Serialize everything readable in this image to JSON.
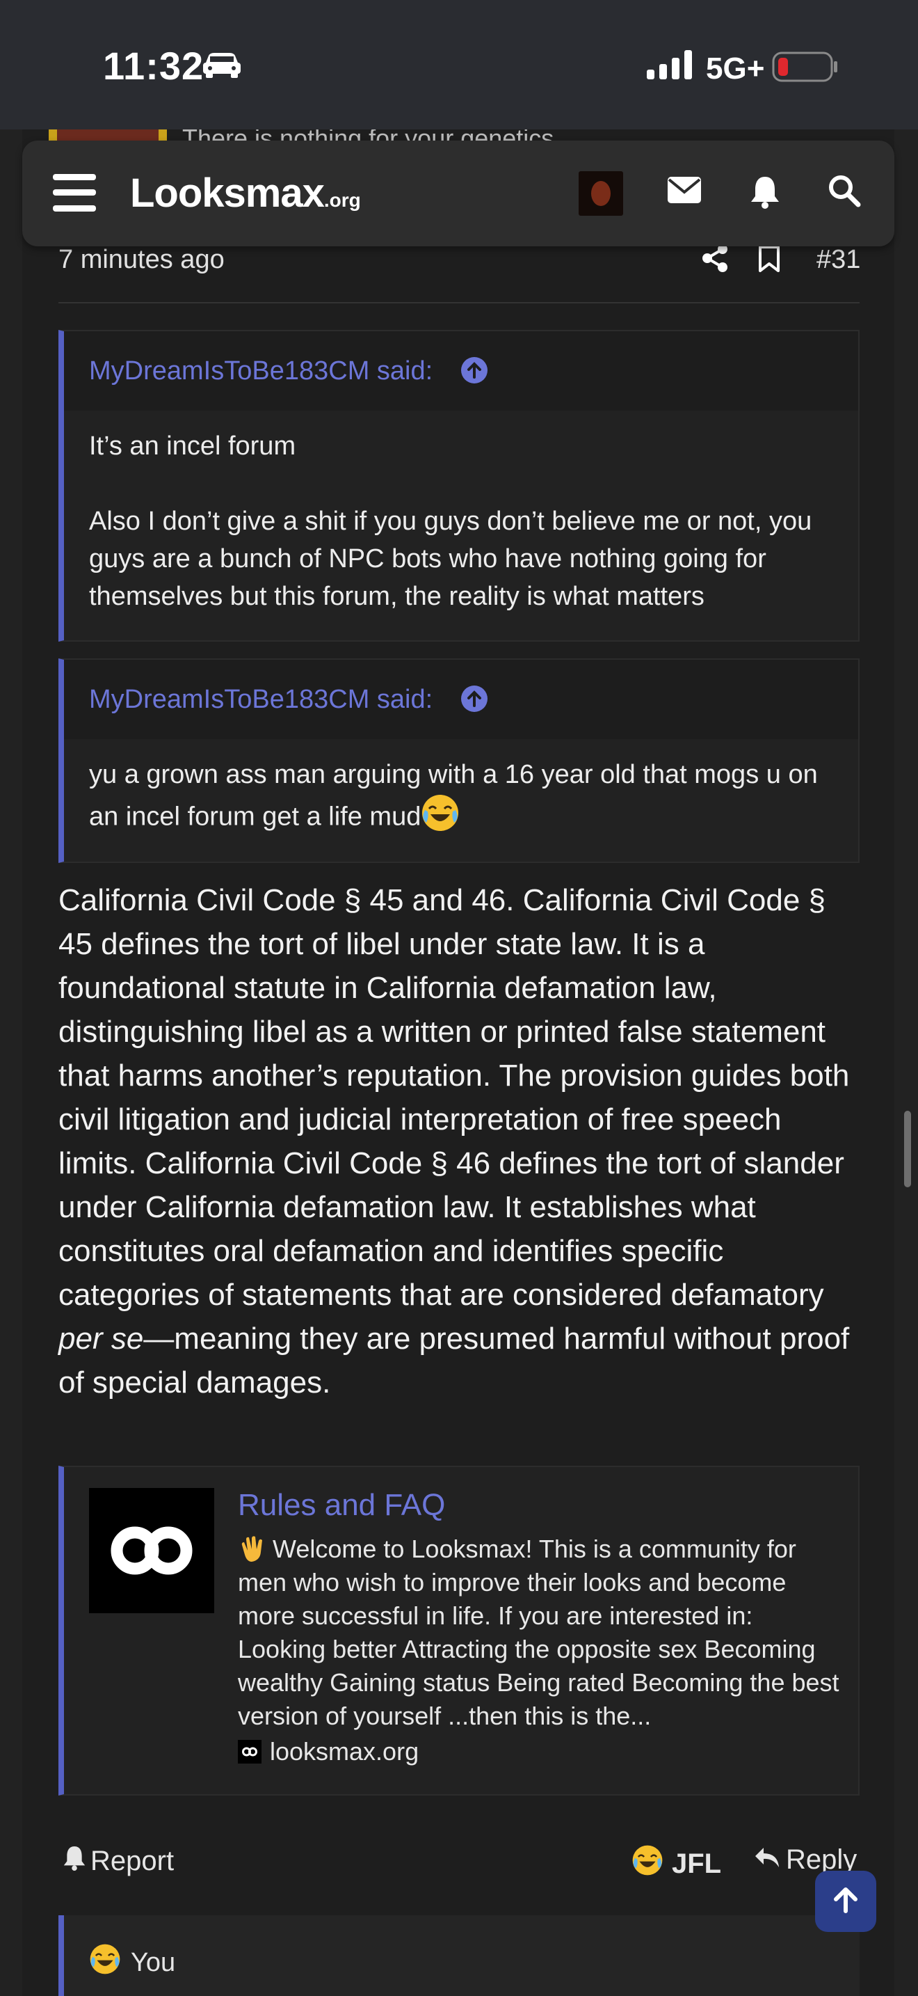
{
  "status_bar": {
    "time": "11:32",
    "network": "5G+"
  },
  "previous_post": {
    "peek_text": "There is nothing for your genetics"
  },
  "navbar": {
    "logo": "Looksmax",
    "logo_suffix": ".org"
  },
  "post": {
    "time": "7 minutes ago",
    "number": "#31",
    "quotes": [
      {
        "author": "MyDreamIsToBe183CM said:",
        "paragraphs": [
          "It’s an incel forum",
          "Also I don’t give a shit if you guys don’t believe me or not, you guys are a bunch of NPC bots who have nothing going for themselves but this forum, the reality is what matters"
        ]
      },
      {
        "author": "MyDreamIsToBe183CM said:",
        "text": "yu a grown ass man arguing with a 16 year old that mogs u on an incel forum get a life mud"
      }
    ],
    "body_part1": "California Civil Code § 45 and 46. California Civil Code § 45 defines the tort of libel under state law. It is a foundational statute in California defamation law, distinguishing libel as a written or printed false statement that harms another’s reputation. The provision guides both civil litigation and judicial interpretation of free speech limits. California Civil Code § 46 defines the tort of slander under California defamation law. It establishes what constitutes oral defamation and identifies specific categories of statements that are considered defamatory ",
    "body_italic": "per se",
    "body_part2": "—meaning they are presumed harmful without proof of special damages.",
    "unfurl": {
      "title": "Rules and FAQ",
      "description": "Welcome to Looksmax! This is a community for men who wish to improve their looks and become more successful in life. If you are interested in: Looking better Attracting the opposite sex Becoming wealthy Gaining status Being rated Becoming the best version of yourself ...then this is the...",
      "domain": "looksmax.org"
    },
    "actions": {
      "report": "Report",
      "reaction": "JFL",
      "reply": "Reply"
    },
    "reactions_summary": "You"
  },
  "colors": {
    "accent": "#5560c4",
    "link": "#6c76d8",
    "background": "#1e1e1e"
  }
}
